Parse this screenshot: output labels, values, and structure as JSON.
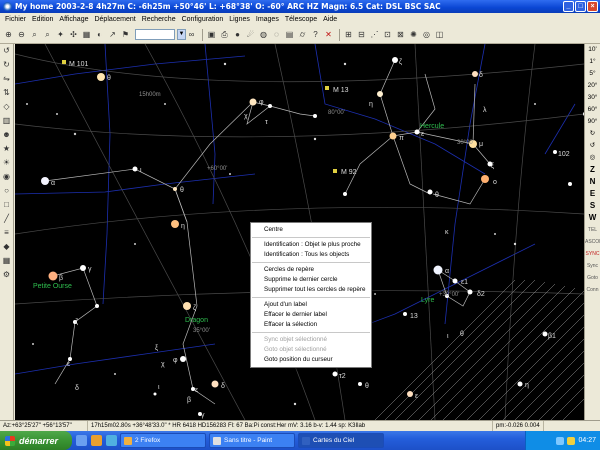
{
  "window": {
    "title": "My home 2003-2-8   4h27m C: -6h25m +50°46' L: +68°38' O: -60° ARC HZ   Magn: 6.5 Cat: DSL BSC SAC"
  },
  "menu": [
    "Fichier",
    "Edition",
    "Affichage",
    "Déplacement",
    "Recherche",
    "Configuration",
    "Lignes",
    "Images",
    "Télescope",
    "Aide"
  ],
  "right_toolbar": [
    "10'",
    "1°",
    "5°",
    "20°",
    "30°",
    "60°",
    "90°",
    "Z",
    "N",
    "E",
    "S",
    "W",
    "TEL",
    "ASCOM",
    "SYNC",
    "Sync",
    "Goto",
    "Conn"
  ],
  "sky_labels": {
    "m101": "M 101",
    "m13": "M 13",
    "m92": "M 92",
    "hercule": "Hercule",
    "petite_ourse": "Petite Ourse",
    "dragon": "Dragon",
    "lyre": "Lyre",
    "ra15": "15h00m",
    "dec80": "80°00'",
    "dec60": "+60°00'",
    "dec30": "+30°00'",
    "dec35": "35°00'",
    "dec_h30": "30°00'",
    "greek_theta1": "θ",
    "greek_alpha": "α",
    "greek_iota": "ι",
    "greek_theta2": "θ",
    "greek_eta": "η",
    "greek_zeta": "ζ",
    "greek_beta": "β",
    "greek_gamma": "γ",
    "greek_zeta2": "ζ",
    "greek_epsilon": "ε",
    "greek_delta": "δ",
    "greek_phi": "φ",
    "greek_chi": "χ",
    "greek_tau": "τ",
    "greek_pi": "π",
    "greek_eta2": "η",
    "greek_zeta3": "ζ",
    "greek_epsilon2": "ε",
    "greek_delta2": "δ",
    "greek_lambda": "λ",
    "greek_mu": "μ",
    "greek_xi": "ξ",
    "greek_omicron": "ο",
    "greek_theta3": "θ",
    "greek_kappa": "κ",
    "num_102": "102",
    "num_13": "13",
    "greek_alpha2": "α",
    "greek_beta1": "β1",
    "greek_delta2b": "δ2",
    "greek_e1": "ε1",
    "greek_theta4": "θ",
    "greek_iota2": "ι",
    "greek_tau2": "τ2",
    "greek_theta5": "θ",
    "greek_epsilon3": "ε",
    "greek_eta3": "η",
    "greek_xi2": "ξ",
    "greek_phi2": "φ",
    "greek_chi2": "χ",
    "greek_iota3": "ι",
    "greek_delta3": "δ",
    "greek_beta2": "β",
    "greek_gamma2": "γ",
    "greek_epsilon4": "ε"
  },
  "context_menu": {
    "items": [
      {
        "label": "Centre",
        "disabled": false
      },
      {
        "sep": true
      },
      {
        "label": "Identification : Objet le plus proche",
        "disabled": false
      },
      {
        "label": "Identification : Tous les objects",
        "disabled": false
      },
      {
        "sep": true
      },
      {
        "label": "Cercles de repère",
        "disabled": false
      },
      {
        "label": "Supprime le dernier cercle",
        "disabled": false
      },
      {
        "label": "Supprimer tout les cercles de repère",
        "disabled": false
      },
      {
        "sep": true
      },
      {
        "label": "Ajout d'un label",
        "disabled": false
      },
      {
        "label": "Effacer le dernier label",
        "disabled": false
      },
      {
        "label": "Effacer la sélection",
        "disabled": false
      },
      {
        "sep": true
      },
      {
        "label": "Sync objet sélectionné",
        "disabled": true
      },
      {
        "label": "Goto objet sélectionné",
        "disabled": true
      },
      {
        "label": "Goto position du curseur",
        "disabled": false
      }
    ]
  },
  "status": {
    "azalt": "Az:+63°25'27\" +56°13'57\"",
    "object": "17h15m02.80s +36°48'33.0\"   * HR 6418 HD156283 Fl: 67 Ba:Pi   const:Her mV: 3.16 b-v: 1.44 sp: K3Ilab",
    "pm": "pm:-0.026  0.004"
  },
  "taskbar": {
    "start": "démarrer",
    "tasks": [
      "2 Firefox",
      "Sans titre - Paint",
      "Cartes du Ciel"
    ],
    "clock": "04:27"
  }
}
